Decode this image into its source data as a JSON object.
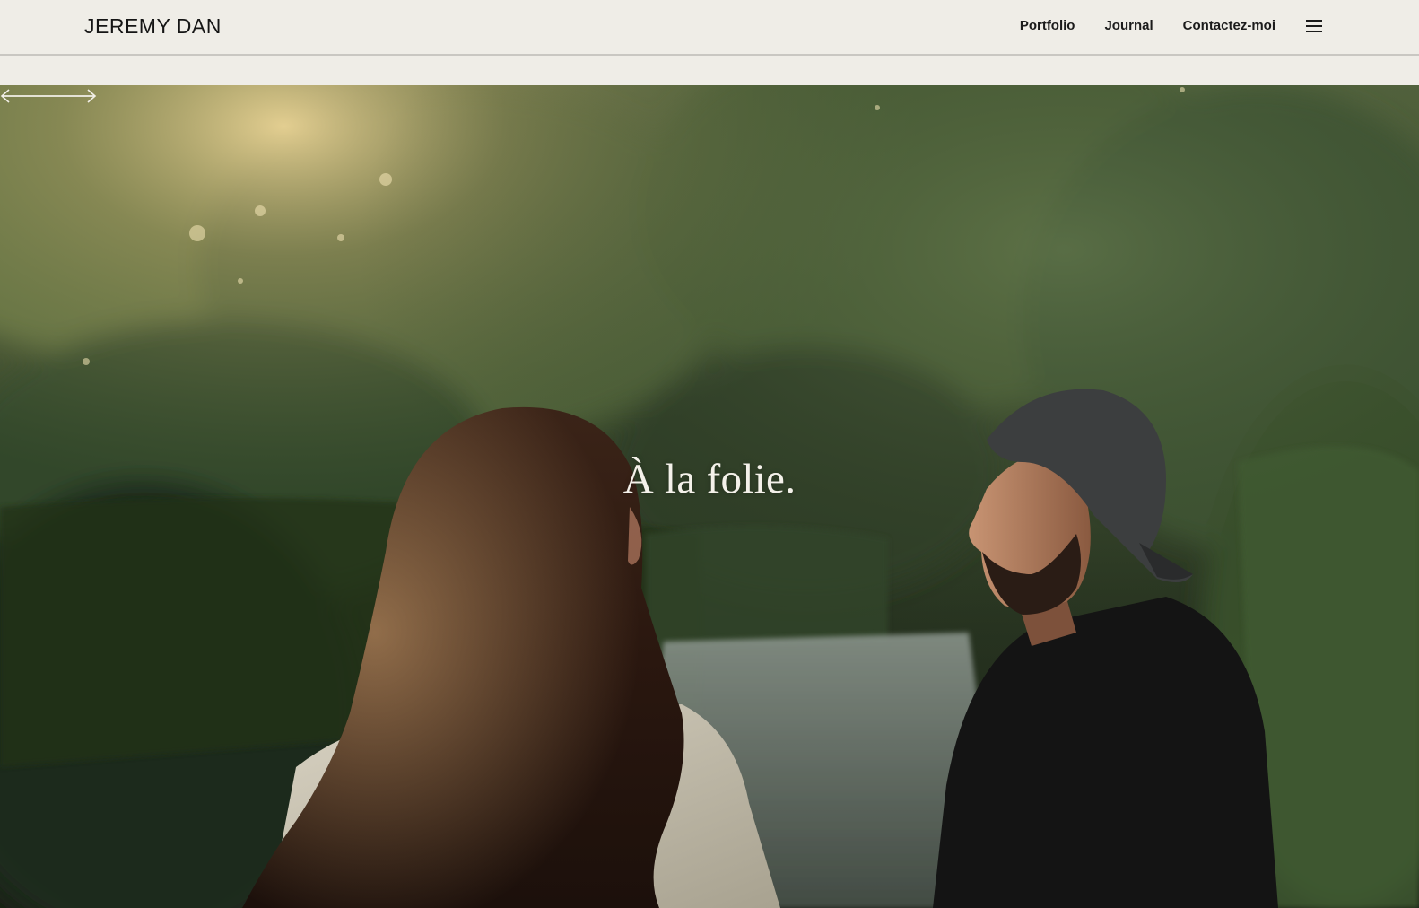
{
  "header": {
    "logo": "JEREMY DAN",
    "nav": [
      {
        "label": "Portfolio"
      },
      {
        "label": "Journal"
      },
      {
        "label": "Contactez-moi"
      }
    ],
    "menu_icon": "hamburger-menu-icon"
  },
  "hero": {
    "title": "À la folie.",
    "prev_icon": "arrow-left-icon",
    "next_icon": "arrow-right-icon"
  },
  "colors": {
    "background": "#efede7",
    "text": "#151515",
    "hero_text": "#f4f1ea"
  }
}
